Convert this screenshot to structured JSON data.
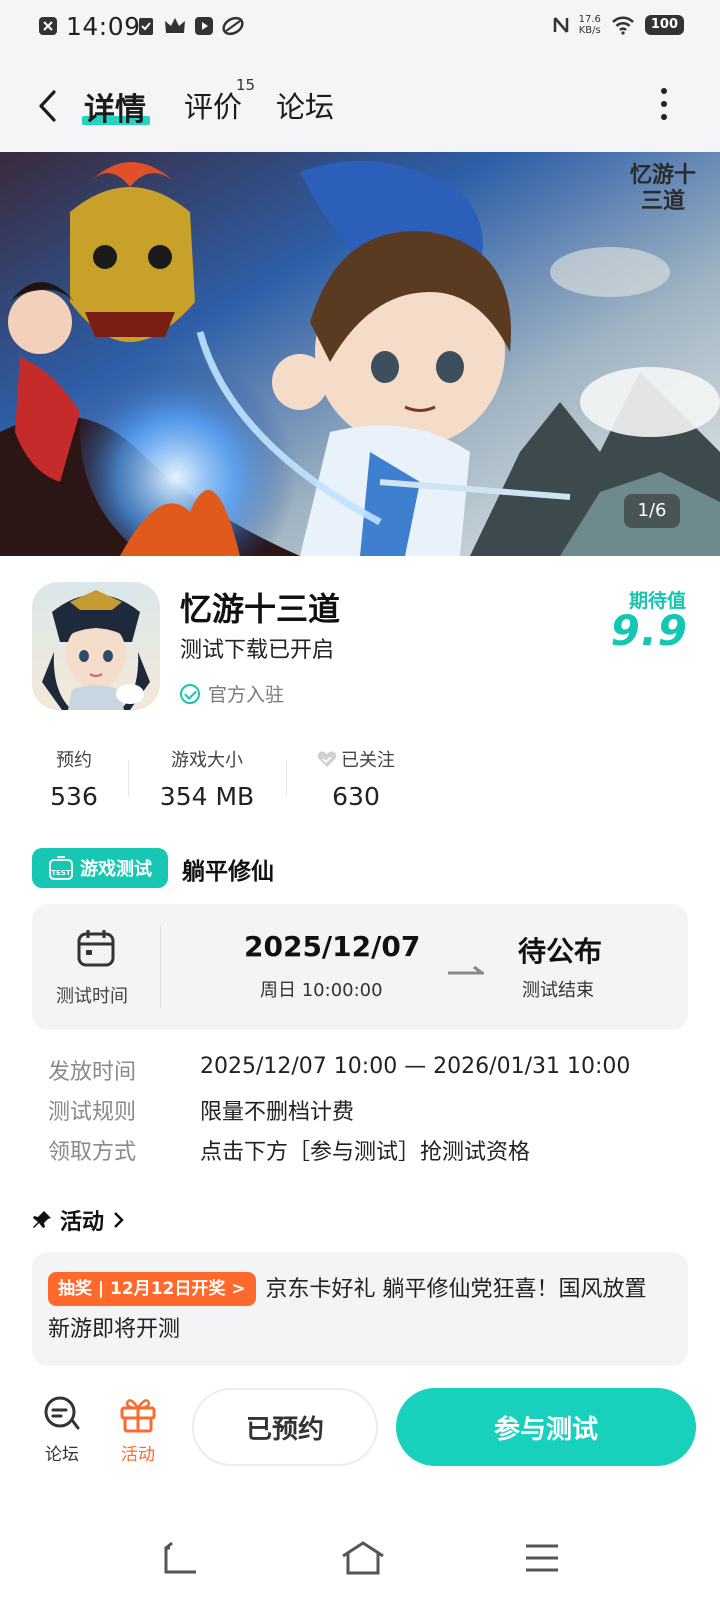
{
  "status_bar": {
    "time": "14:09",
    "net_speed_value": "17.6",
    "net_speed_unit": "KB/s",
    "battery": "100",
    "icons": [
      "close-notification-icon",
      "clipboard-icon",
      "crown-icon",
      "video-icon",
      "leaf-icon",
      "nfc-icon",
      "wifi-icon",
      "battery-icon"
    ]
  },
  "nav": {
    "tabs": [
      {
        "label": "详情",
        "active": true
      },
      {
        "label": "评价",
        "badge": "15"
      },
      {
        "label": "论坛"
      }
    ]
  },
  "banner": {
    "counter": "1/6",
    "logo_text": "忆游十三道"
  },
  "app": {
    "name": "忆游十三道",
    "subtitle": "测试下载已开启",
    "official": "官方入驻",
    "expect_label": "期待值",
    "expect_value": "9.9"
  },
  "stats": [
    {
      "label": "预约",
      "value": "536"
    },
    {
      "label": "游戏大小",
      "value": "354 MB"
    },
    {
      "label": "已关注",
      "value": "630"
    }
  ],
  "test": {
    "chip_label": "游戏测试",
    "chip_icon_text": "TEST",
    "name": "躺平修仙",
    "time_label": "测试时间",
    "start_date": "2025/12/07",
    "start_time": "周日  10:00:00",
    "end_value": "待公布",
    "end_label": "测试结束"
  },
  "details": [
    {
      "key": "发放时间",
      "value": "2025/12/07 10:00 — 2026/01/31 10:00"
    },
    {
      "key": "测试规则",
      "value": "限量不删档计费"
    },
    {
      "key": "领取方式",
      "value": "点击下方［参与测试］抢测试资格"
    }
  ],
  "activity": {
    "title": "活动",
    "badge": "抽奖 | 12月12日开奖 >",
    "text": "京东卡好礼 躺平修仙党狂喜！国风放置新游即将开测"
  },
  "bottom_bar": {
    "forum_label": "论坛",
    "activity_label": "活动",
    "reserved_label": "已预约",
    "join_label": "参与测试"
  },
  "colors": {
    "accent": "#18d1bd",
    "orange": "#ff6a2c",
    "card_bg": "#f4f4f6"
  }
}
